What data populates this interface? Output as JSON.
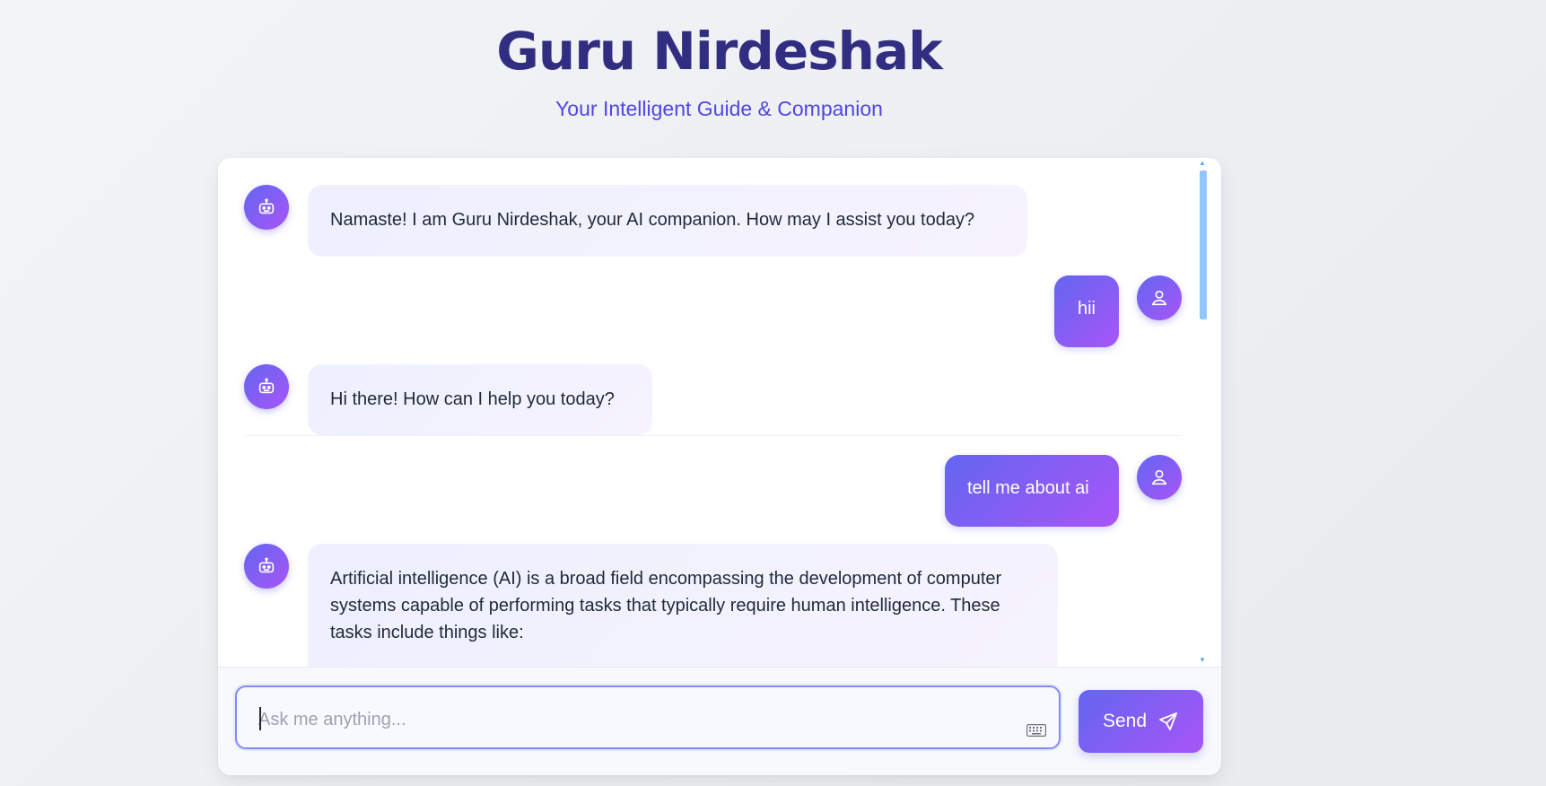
{
  "header": {
    "title": "Guru Nirdeshak",
    "subtitle": "Your Intelligent Guide & Companion"
  },
  "messages": [
    {
      "role": "bot",
      "avatar_icon": "robot-icon",
      "text": "Namaste! I am Guru Nirdeshak, your AI companion. How may I assist you today?"
    },
    {
      "role": "user",
      "avatar_icon": "user-icon",
      "text": "hii"
    },
    {
      "role": "bot",
      "avatar_icon": "robot-icon",
      "text": "Hi there! How can I help you today?"
    },
    {
      "role": "user",
      "avatar_icon": "user-icon",
      "text": "tell me about ai"
    },
    {
      "role": "bot",
      "avatar_icon": "robot-icon",
      "text": "Artificial intelligence (AI) is a broad field encompassing the development of computer systems capable of performing tasks that typically require human intelligence.  These tasks include things like:"
    }
  ],
  "composer": {
    "placeholder": "Ask me anything...",
    "value": "",
    "send_label": "Send",
    "keyboard_icon": "keyboard-icon",
    "send_icon": "send-icon"
  },
  "colors": {
    "accent_start": "#6366f1",
    "accent_end": "#a855f7",
    "title": "#312e81",
    "subtitle": "#4f46e5"
  }
}
